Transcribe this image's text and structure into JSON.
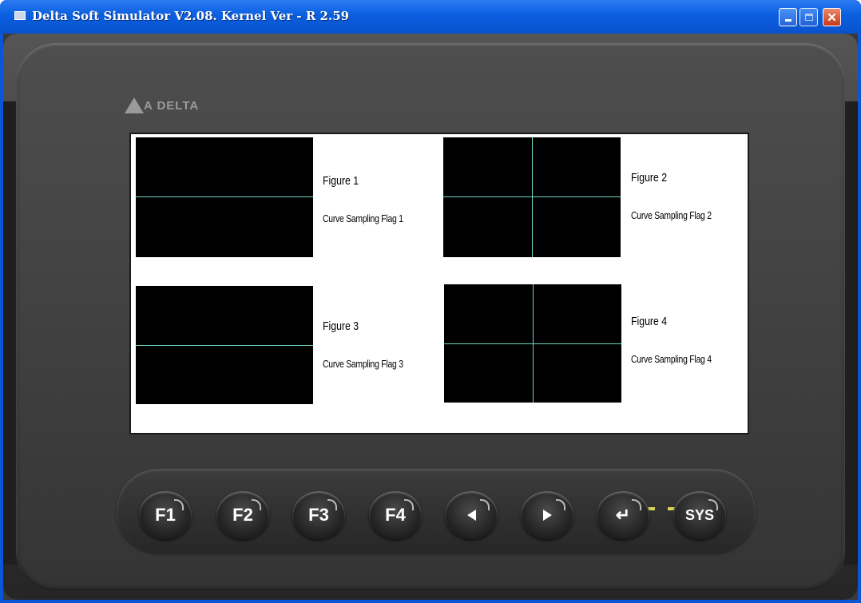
{
  "window": {
    "title": "Delta Soft Simulator V2.08. Kernel Ver - R 2.59",
    "controls": [
      "minimize",
      "maximize",
      "close"
    ]
  },
  "device": {
    "logo_text": "A DELTA"
  },
  "screen": {
    "panels": [
      {
        "figure": "Figure 1",
        "flag": "Curve Sampling Flag 1",
        "grid": "horizontal"
      },
      {
        "figure": "Figure 2",
        "flag": "Curve Sampling Flag 2",
        "grid": "cross"
      },
      {
        "figure": "Figure 3",
        "flag": "Curve Sampling Flag 3",
        "grid": "horizontal"
      },
      {
        "figure": "Figure 4",
        "flag": "Curve Sampling Flag 4",
        "grid": "cross"
      }
    ]
  },
  "keypad": {
    "keys": [
      "F1",
      "F2",
      "F3",
      "F4",
      "left-arrow",
      "right-arrow",
      "enter",
      "SYS"
    ]
  },
  "colors": {
    "grid_line": "#6fd6c6",
    "trend_bg": "#000000",
    "led": "#d9d35a",
    "titlebar": "#0a5fe0"
  }
}
